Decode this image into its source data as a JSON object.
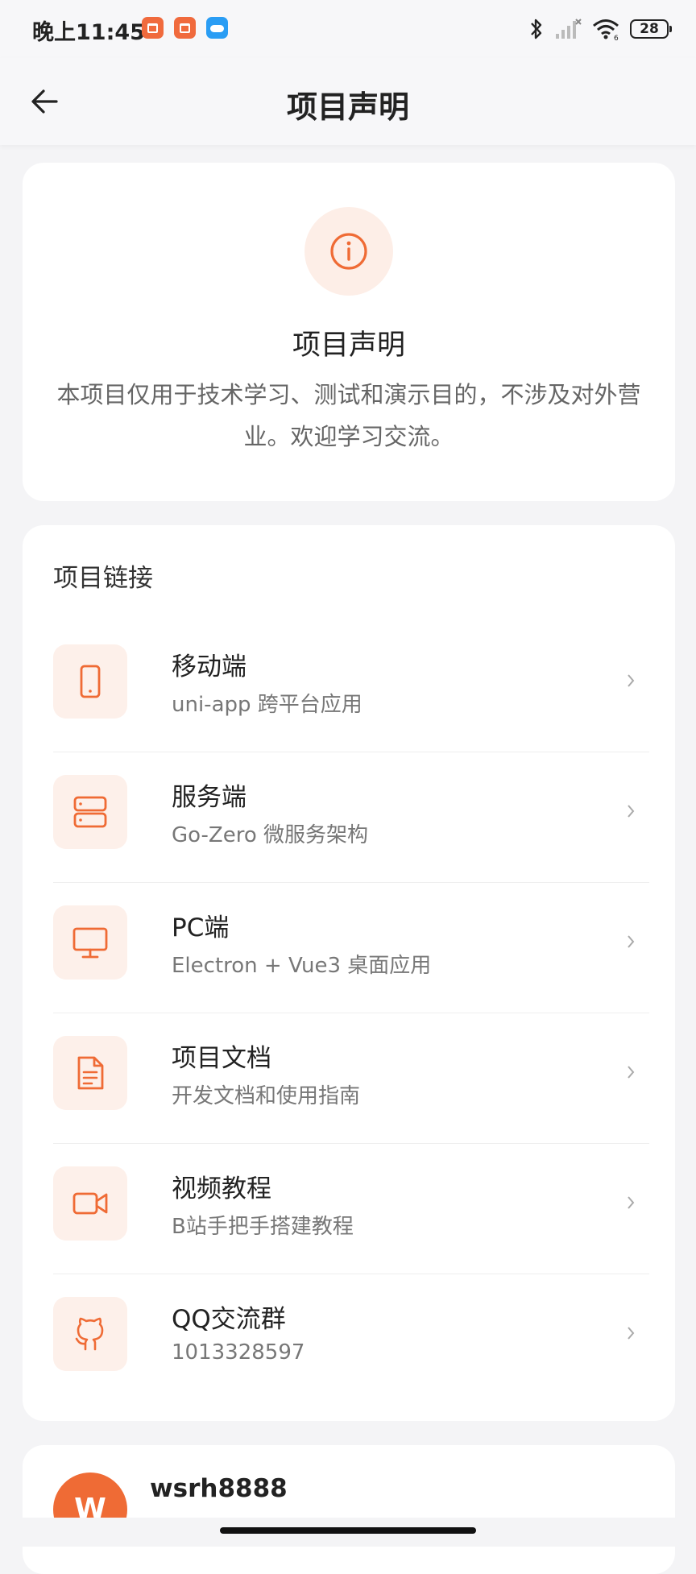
{
  "status_bar": {
    "time": "晚上11:45",
    "battery": "28"
  },
  "nav": {
    "title": "项目声明"
  },
  "notice": {
    "title": "项目声明",
    "text": "本项目仅用于技术学习、测试和演示目的，不涉及对外营业。欢迎学习交流。"
  },
  "links": {
    "section_title": "项目链接",
    "items": [
      {
        "title": "移动端",
        "subtitle": "uni-app 跨平台应用",
        "icon": "mobile-icon"
      },
      {
        "title": "服务端",
        "subtitle": "Go-Zero 微服务架构",
        "icon": "server-icon"
      },
      {
        "title": "PC端",
        "subtitle": "Electron + Vue3 桌面应用",
        "icon": "monitor-icon"
      },
      {
        "title": "项目文档",
        "subtitle": "开发文档和使用指南",
        "icon": "document-icon"
      },
      {
        "title": "视频教程",
        "subtitle": "B站手把手搭建教程",
        "icon": "video-icon"
      },
      {
        "title": "QQ交流群",
        "subtitle": "1013328597",
        "icon": "github-icon"
      }
    ]
  },
  "user": {
    "avatar_letter": "W",
    "name": "wsrh8888"
  },
  "colors": {
    "accent": "#ef6b35",
    "icon_bg": "#fdf0ea"
  }
}
